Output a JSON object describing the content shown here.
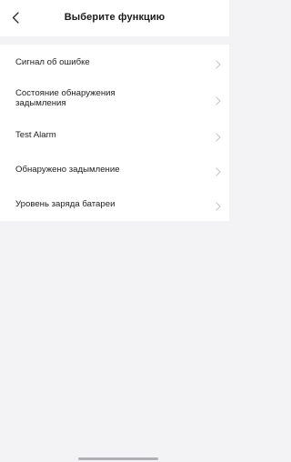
{
  "header": {
    "title": "Выберите функцию",
    "back_icon": "chevron-left-icon"
  },
  "functions": [
    {
      "label": "Сигнал об ошибке",
      "icon": "chevron-right-icon"
    },
    {
      "label": "Состояние обнаружения задымления",
      "icon": "chevron-right-icon"
    },
    {
      "label": "Test Alarm",
      "icon": "chevron-right-icon"
    },
    {
      "label": "Обнаружено задымление",
      "icon": "chevron-right-icon"
    },
    {
      "label": "Уровень заряда батареи",
      "icon": "chevron-right-icon"
    }
  ],
  "colors": {
    "background": "#f3f3f5",
    "surface": "#ffffff",
    "chevron": "#c7c7cc"
  }
}
